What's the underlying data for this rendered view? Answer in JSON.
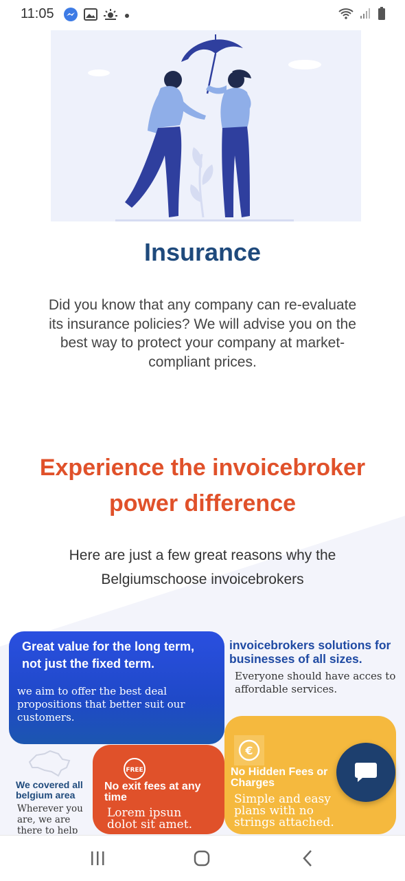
{
  "status_bar": {
    "time": "11:05",
    "left_icons": [
      "messenger-icon",
      "image-icon",
      "weather-icon",
      "dot-icon"
    ],
    "right_icons": [
      "wifi-icon",
      "signal-icon",
      "battery-icon"
    ]
  },
  "hero": {
    "illustration": "umbrella-people-illustration"
  },
  "insurance": {
    "title": "Insurance",
    "description": "Did you know that any company can re-evaluate its insurance policies? We will advise you on the best way to protect your company at market-compliant prices."
  },
  "experience": {
    "title_line1": "Experience the invoicebroker",
    "title_line2": "power difference",
    "subtitle_line1": "Here are just a few great reasons why the",
    "subtitle_line2": "Belgiumschoose invoicebrokers"
  },
  "cards": {
    "long_term": {
      "title": "Great value for the long term, not just the fixed term.",
      "text": "we aim to offer the best deal propositions that better suit our customers."
    },
    "solutions": {
      "title": "invoicebrokers solutions for businesses of all sizes.",
      "text": "Everyone should have acces to affordable services."
    },
    "belgium": {
      "title": "We covered all belgium area",
      "text": "Wherever you are, we are there to help you"
    },
    "exit_fees": {
      "icon_label": "FREE",
      "title": "No exit fees at any time",
      "text": "Lorem ipsun dolot sit amet."
    },
    "hidden_fees": {
      "icon_label": "€",
      "title": "No Hidden Fees or Charges",
      "text": "Simple and easy plans with no strings attached."
    }
  },
  "colors": {
    "navy": "#1f4a7c",
    "orange": "#e0512a",
    "blue": "#2a4fe0",
    "yellow": "#f5b93e"
  },
  "nav": {
    "buttons": [
      "recent-apps",
      "home",
      "back"
    ]
  }
}
